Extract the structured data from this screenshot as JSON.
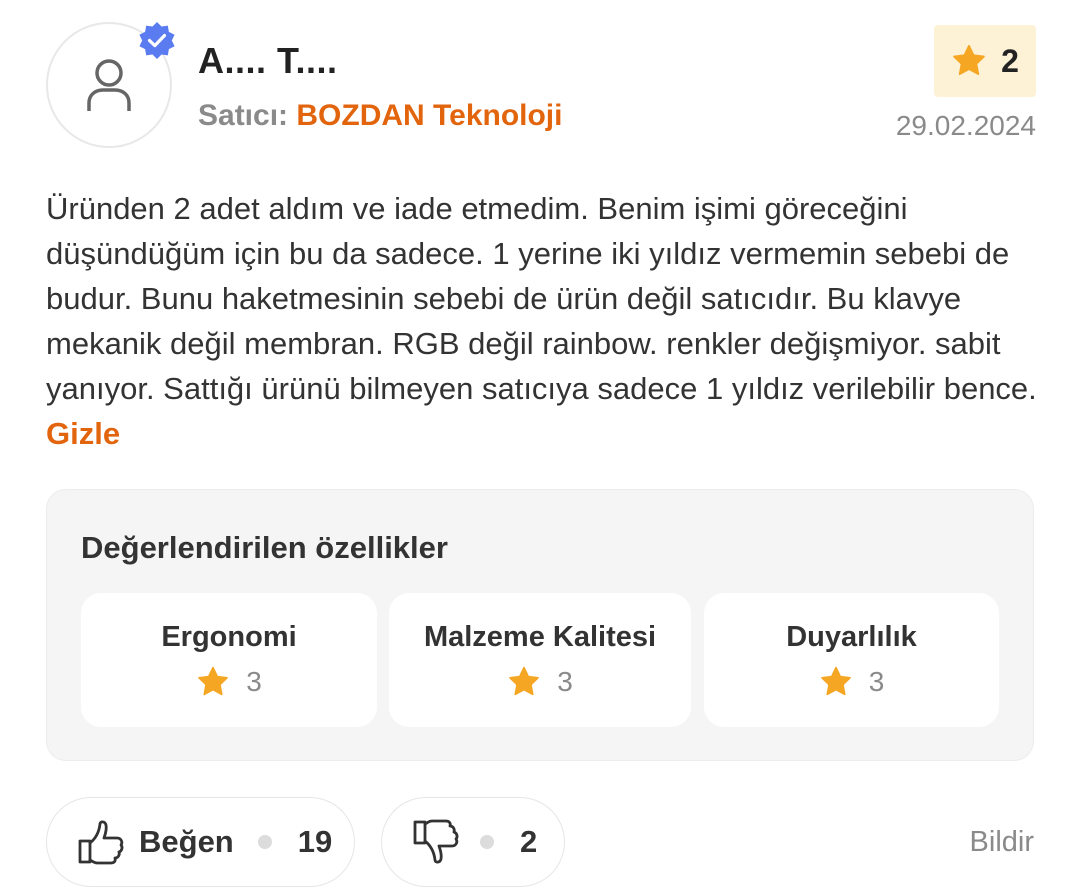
{
  "review": {
    "user_name": "A.... T....",
    "seller_prefix": "Satıcı:",
    "seller_name": "BOZDAN Teknoloji",
    "rating": "2",
    "date": "29.02.2024",
    "text": "Üründen 2 adet aldım ve iade etmedim. Benim işimi göreceğini düşündüğüm için bu da sadece. 1 yerine iki yıldız vermemin sebebi de budur. Bunu haketmesinin sebebi de ürün değil satıcıdır. Bu klavye mekanik değil membran. RGB değil rainbow. renkler değişmiyor. sabit yanıyor. Sattığı ürünü bilmeyen satıcıya sadece 1 yıldız verilebilir bence. ",
    "hide_label": "Gizle"
  },
  "features": {
    "title": "Değerlendirilen özellikler",
    "items": [
      {
        "name": "Ergonomi",
        "score": "3"
      },
      {
        "name": "Malzeme Kalitesi",
        "score": "3"
      },
      {
        "name": "Duyarlılık",
        "score": "3"
      }
    ]
  },
  "actions": {
    "like_label": "Beğen",
    "like_count": "19",
    "dislike_count": "2",
    "report_label": "Bildir"
  },
  "colors": {
    "accent": "#e2650e",
    "star": "#f5a623",
    "verified": "#5b7cf0",
    "badge_bg": "#fdf1d6"
  },
  "icons": [
    "user-icon",
    "verified-icon",
    "star-icon",
    "thumbs-up-icon",
    "thumbs-down-icon"
  ]
}
